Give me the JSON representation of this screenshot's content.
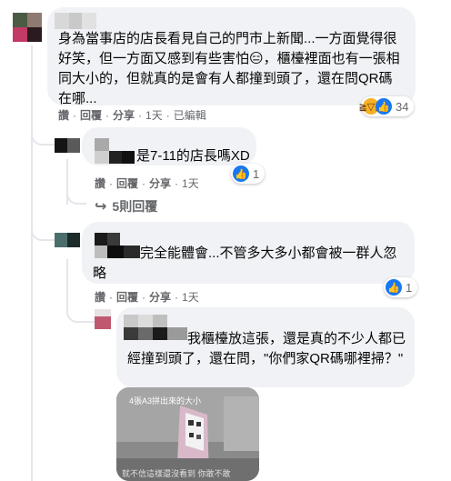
{
  "main_comment": {
    "text": "身為當事店的店長看見自己的門市上新聞...一方面覺得很好笑，但一方面又感到有些害怕😑，櫃檯裡面也有一張相同大小的，但就真的是會有人都撞到頭了，還在問QR碼在哪...",
    "actions": {
      "like": "讚",
      "reply": "回覆",
      "share": "分享",
      "time": "1天",
      "edited": "已編輯"
    },
    "reaction_count": "34"
  },
  "reply_1": {
    "text": "是7-11的店長嗎XD",
    "actions": {
      "like": "讚",
      "reply": "回覆",
      "share": "分享",
      "time": "1天"
    },
    "reaction_count": "1"
  },
  "more_replies": {
    "label": "5則回覆"
  },
  "reply_2": {
    "text": "完全能體會...不管多大多小都會被一群人忽略",
    "actions": {
      "like": "讚",
      "reply": "回覆",
      "share": "分享",
      "time": "1天"
    },
    "reaction_count": "1"
  },
  "reply_3": {
    "text": "我櫃檯放這張，還是真的不少人都已經撞到頭了，還在問，\"你們家QR碼哪裡掃？\"",
    "photo_caption_top": "4張A3拼出來的大小",
    "photo_caption_bottom": "就不信這樣還沒看到 你敢不敢"
  },
  "colors": {
    "like_blue": "#1877f2",
    "haha_yellow": "#f7b125",
    "bubble_bg": "#f0f2f5",
    "meta_gray": "#65676b"
  }
}
